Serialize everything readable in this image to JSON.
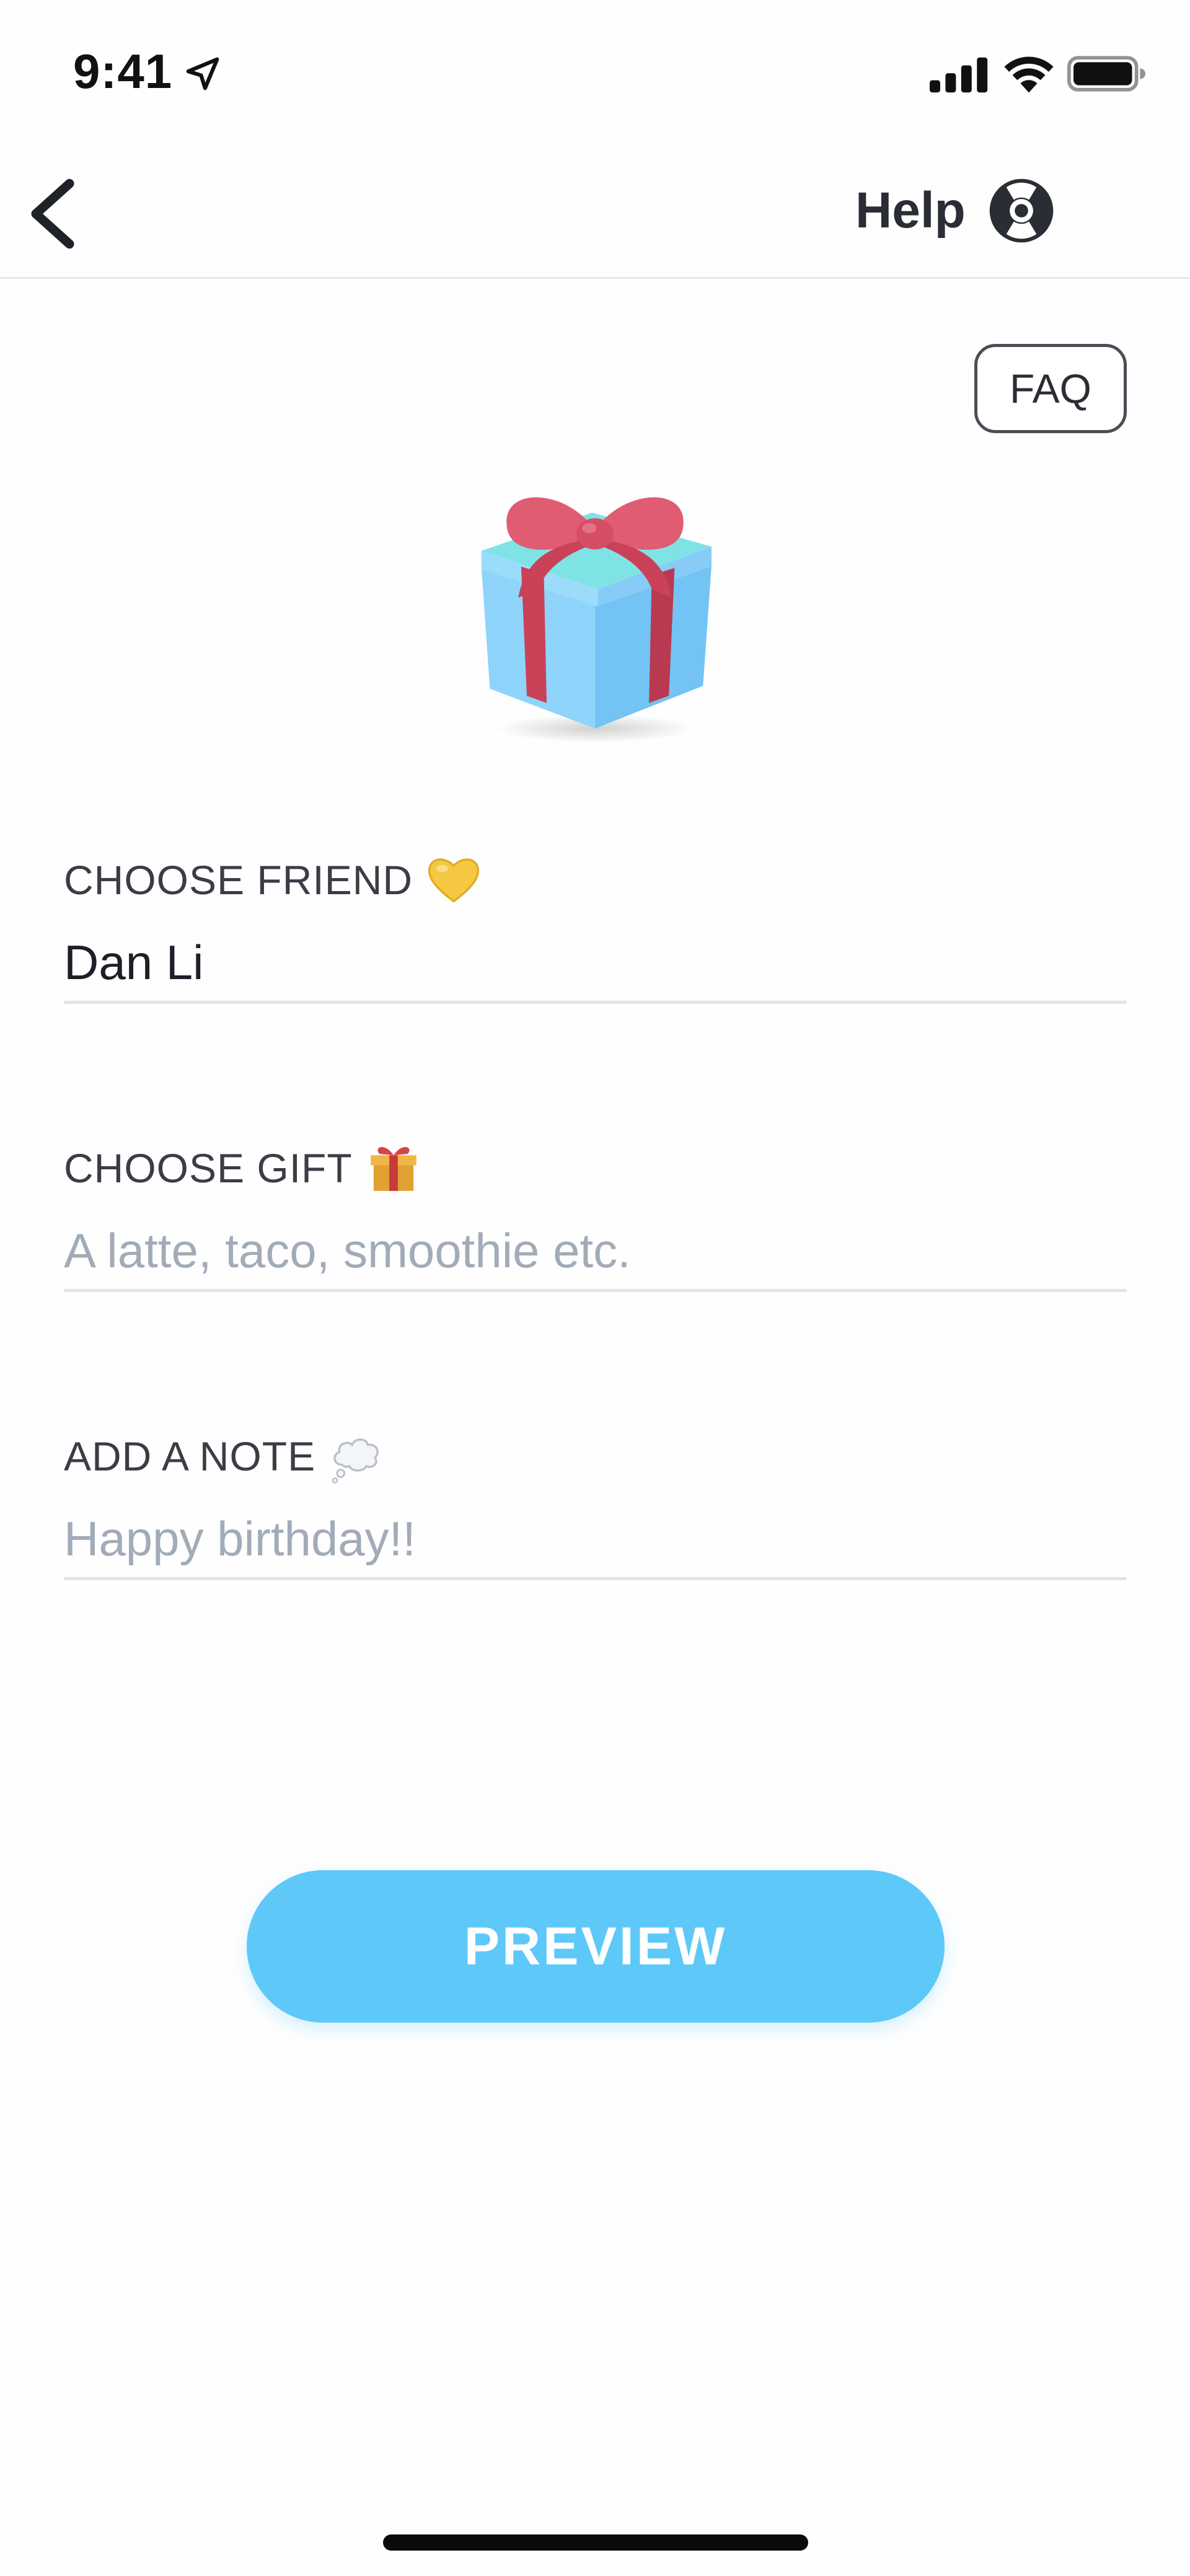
{
  "status_bar": {
    "time": "9:41",
    "location_icon": "location-arrow-icon",
    "signal_icon": "cellular-signal-icon",
    "wifi_icon": "wifi-icon",
    "battery_icon": "battery-full-icon"
  },
  "nav": {
    "back_icon": "chevron-left-icon",
    "help_label": "Help",
    "help_icon": "lifebuoy-icon"
  },
  "faq_label": "FAQ",
  "hero_icon": "gift-box-icon",
  "form": {
    "friend": {
      "label": "CHOOSE FRIEND",
      "emoji": "yellow-heart-icon",
      "value": "Dan Li"
    },
    "gift": {
      "label": "CHOOSE GIFT",
      "emoji": "wrapped-gift-icon",
      "placeholder": "A latte, taco, smoothie etc."
    },
    "note": {
      "label": "ADD A NOTE",
      "emoji": "thought-balloon-icon",
      "placeholder": "Happy birthday!!"
    }
  },
  "preview_label": "PREVIEW",
  "colors": {
    "accent": "#5ec9f8",
    "placeholder": "#a2abb8",
    "divider": "#e1e4ea",
    "ribbon": "#d9485f",
    "gift_box": "#8fd4fb"
  }
}
